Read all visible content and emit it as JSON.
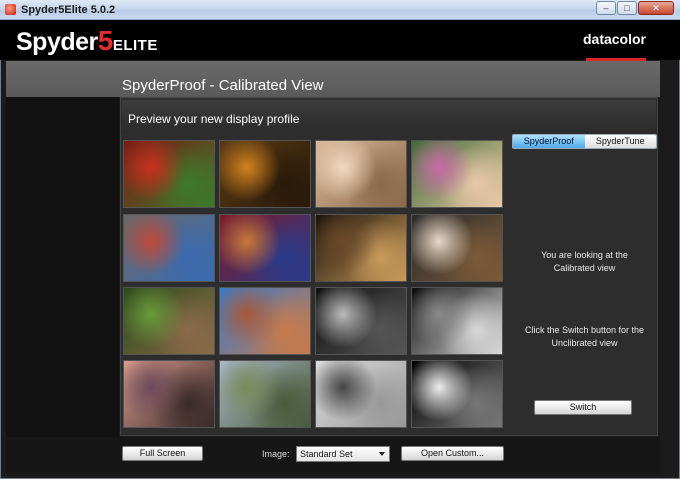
{
  "window": {
    "title": "Spyder5Elite 5.0.2",
    "controls": [
      "–",
      "□",
      "✕"
    ]
  },
  "brand": {
    "logo_main": "Spyder",
    "logo_num": "5",
    "logo_sub": "ELITE",
    "company": "datacolor",
    "accent": "#d9262b"
  },
  "page": {
    "title": "SpyderProof - Calibrated View",
    "subtitle": "Preview your new display profile"
  },
  "tabs": [
    {
      "label": "SpyderProof",
      "active": true
    },
    {
      "label": "SpyderTune",
      "active": false
    }
  ],
  "info": {
    "line1": "You are looking at the",
    "line2": "Calibrated view",
    "line3": "Click the Switch button for the",
    "line4": "Unclibrated view"
  },
  "buttons": {
    "switch": "Switch",
    "full_screen": "Full Screen",
    "open_custom": "Open Custom..."
  },
  "image_select": {
    "label": "Image:",
    "value": "Standard Set"
  },
  "thumbnails": [
    {
      "name": "peppers-thumbnail",
      "colors": [
        "#7a1a14",
        "#c9301e",
        "#3d7a2a"
      ]
    },
    {
      "name": "spice-bowls-thumbnail",
      "colors": [
        "#5a3a14",
        "#d2831e",
        "#2a1a0a"
      ]
    },
    {
      "name": "woman-portrait-thumbnail",
      "colors": [
        "#d8b89a",
        "#f0d8c0",
        "#8a6a4a"
      ]
    },
    {
      "name": "girl-with-flowers-thumbnail",
      "colors": [
        "#3e6a34",
        "#c86aa8",
        "#e8c8a8"
      ]
    },
    {
      "name": "color-checker-thumbnail",
      "colors": [
        "#6a6a6a",
        "#c04a3a",
        "#3a6ab0"
      ]
    },
    {
      "name": "fabric-stripes-thumbnail",
      "colors": [
        "#7a1a2a",
        "#c8783a",
        "#2a3a8a"
      ]
    },
    {
      "name": "guitar-player-thumbnail",
      "colors": [
        "#1a120a",
        "#6a4a2a",
        "#c89a5a"
      ]
    },
    {
      "name": "marilyn-statue-thumbnail",
      "colors": [
        "#2a2a2a",
        "#e8d8c8",
        "#7a5a3a"
      ]
    },
    {
      "name": "garden-urn-thumbnail",
      "colors": [
        "#2a4a1a",
        "#6a9a3a",
        "#8a6a4a"
      ]
    },
    {
      "name": "church-thumbnail",
      "colors": [
        "#3a7ac8",
        "#a85a3a",
        "#c87a4a"
      ]
    },
    {
      "name": "bw-portrait-thumbnail",
      "colors": [
        "#111111",
        "#bbbbbb",
        "#555555"
      ]
    },
    {
      "name": "spiral-staircase-thumbnail",
      "colors": [
        "#0a0a0a",
        "#8a8a8a",
        "#d8d8d8"
      ]
    },
    {
      "name": "sunset-landscape-thumbnail",
      "colors": [
        "#d89a8a",
        "#6a4a5a",
        "#3a2a2a"
      ]
    },
    {
      "name": "rolling-hills-thumbnail",
      "colors": [
        "#a8b8c8",
        "#7a8a5a",
        "#4a5a3a"
      ]
    },
    {
      "name": "bw-abstract-thumbnail",
      "colors": [
        "#dddddd",
        "#444444",
        "#999999"
      ]
    },
    {
      "name": "grayscale-test-thumbnail",
      "colors": [
        "#000000",
        "#eeeeee",
        "#777777"
      ]
    }
  ]
}
